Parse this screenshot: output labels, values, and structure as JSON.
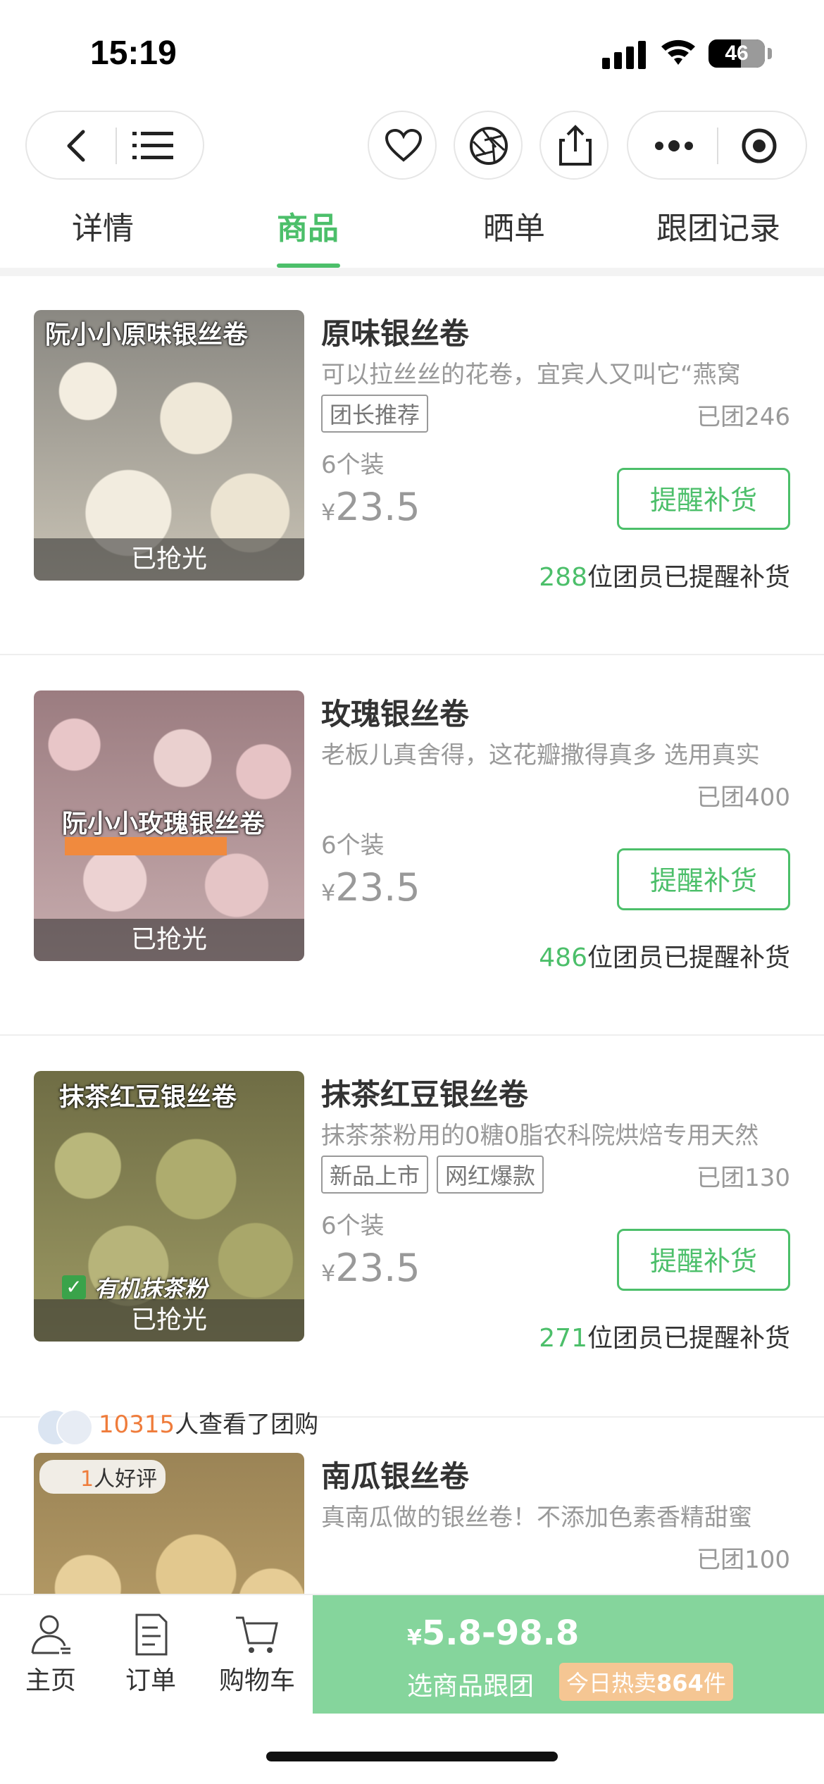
{
  "status_bar": {
    "time": "15:19",
    "battery": "46"
  },
  "tabs": [
    {
      "label": "详情"
    },
    {
      "label": "商品"
    },
    {
      "label": "晒单"
    },
    {
      "label": "跟团记录"
    }
  ],
  "products": [
    {
      "name": "原味银丝卷",
      "image_title": "阮小小原味银丝卷",
      "description": "可以拉丝丝的花卷，宜宾人又叫它“燕窝",
      "tags": [
        "团长推荐"
      ],
      "sold": "已团246",
      "pack": "6个装",
      "currency": "¥",
      "price": "23.5",
      "status": "已抢光",
      "remind_button": "提醒补货",
      "reminded_count": "288",
      "reminded_suffix": "位团员已提醒补货"
    },
    {
      "name": "玫瑰银丝卷",
      "image_title": "阮小小玫瑰银丝卷",
      "description": "老板儿真舍得，这花瓣撒得真多 选用真实",
      "tags": [],
      "sold": "已团400",
      "pack": "6个装",
      "currency": "¥",
      "price": "23.5",
      "status": "已抢光",
      "remind_button": "提醒补货",
      "reminded_count": "486",
      "reminded_suffix": "位团员已提醒补货"
    },
    {
      "name": "抹茶红豆银丝卷",
      "image_title": "抹茶红豆银丝卷",
      "image_caption": "有机抹茶粉",
      "description": "抹茶茶粉用的0糖0脂农科院烘焙专用天然",
      "tags": [
        "新品上市",
        "网红爆款"
      ],
      "sold": "已团130",
      "pack": "6个装",
      "currency": "¥",
      "price": "23.5",
      "status": "已抢光",
      "remind_button": "提醒补货",
      "reminded_count": "271",
      "reminded_suffix": "位团员已提醒补货"
    },
    {
      "name": "南瓜银丝卷",
      "description": "真南瓜做的银丝卷！不添加色素香精甜蜜",
      "sold": "已团100",
      "review_badge_count": "1",
      "review_badge_suffix": "人好评"
    }
  ],
  "viewers": {
    "count": "10315",
    "suffix": "人查看了团购"
  },
  "bottom_bar": {
    "home": "主页",
    "orders": "订单",
    "cart": "购物车",
    "currency": "¥",
    "price_range": "5.8-98.8",
    "action": "选商品跟团",
    "hot_prefix": "今日热卖",
    "hot_count": "864",
    "hot_suffix": "件"
  },
  "colors": {
    "accent": "#4cbf6a",
    "buy_bg": "#85d59c",
    "orange": "#ef7c3b"
  },
  "icons": [
    "back-icon",
    "menu-list-icon",
    "heart-icon",
    "aperture-icon",
    "share-icon",
    "more-dots-icon",
    "record-icon",
    "home-icon",
    "orders-icon",
    "cart-icon"
  ]
}
